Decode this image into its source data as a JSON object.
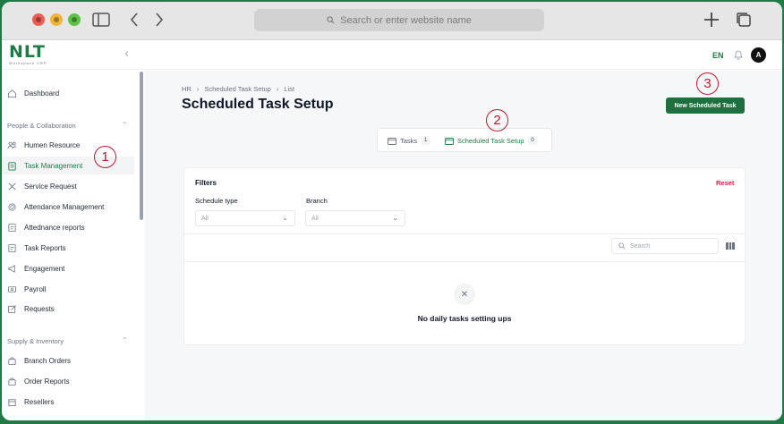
{
  "browser": {
    "url_placeholder": "Search or enter website name",
    "colors": {
      "close": "#ee5b52",
      "minimize": "#f2b43d",
      "zoom": "#5cc443"
    }
  },
  "header": {
    "logo_text": "NLT",
    "logo_subtext": "Workspace CRP",
    "language": "EN",
    "avatar_initial": "A",
    "brand_color": "#1f7a45"
  },
  "sidebar": {
    "items": [
      {
        "label": "Dashboard",
        "icon": "home-icon"
      },
      {
        "label": "Humen Resource",
        "icon": "people-icon"
      },
      {
        "label": "Task Management",
        "icon": "clipboard-icon",
        "active": true
      },
      {
        "label": "Service Request",
        "icon": "tools-icon"
      },
      {
        "label": "Attendance Management",
        "icon": "fingerprint-icon"
      },
      {
        "label": "Attednance reports",
        "icon": "report-icon"
      },
      {
        "label": "Task Reports",
        "icon": "report-icon"
      },
      {
        "label": "Engagement",
        "icon": "megaphone-icon"
      },
      {
        "label": "Payroll",
        "icon": "money-icon"
      },
      {
        "label": "Requests",
        "icon": "edit-icon"
      },
      {
        "label": "Branch Orders",
        "icon": "bag-icon"
      },
      {
        "label": "Order Reports",
        "icon": "bag-icon"
      },
      {
        "label": "Resellers",
        "icon": "store-icon"
      }
    ],
    "sections": {
      "people": "People & Collaboration",
      "supply": "Supply & Inventory"
    }
  },
  "main": {
    "breadcrumb": [
      "HR",
      "Scheduled Task Setup",
      "List"
    ],
    "title": "Scheduled Task Setup",
    "new_button": "New Scheduled Task",
    "tabs": [
      {
        "label": "Tasks",
        "count": "1"
      },
      {
        "label": "Scheduled Task Setup",
        "count": "0",
        "active": true
      }
    ],
    "filters": {
      "title": "Filters",
      "reset": "Reset",
      "schedule_type_label": "Schedule type",
      "schedule_type_value": "All",
      "branch_label": "Branch",
      "branch_value": "All"
    },
    "search_placeholder": "Search",
    "empty_message": "No daily tasks setting ups"
  },
  "annotations": [
    "1",
    "2",
    "3"
  ]
}
